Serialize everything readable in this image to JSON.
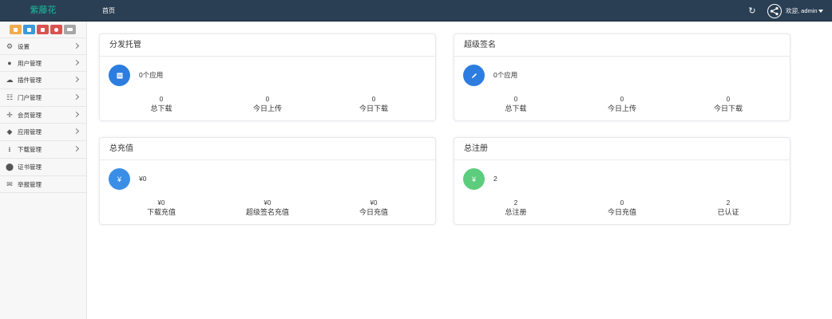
{
  "header": {
    "brand": "紫藤花",
    "nav_home": "首页",
    "welcome": "欢迎, admin",
    "refresh_icon": "refresh-icon",
    "avatar_icon": "share-nodes-icon"
  },
  "sidebar": {
    "quick_buttons": [
      {
        "icon": "home-icon",
        "color": "#f0ad4e"
      },
      {
        "icon": "file-icon",
        "color": "#3a9ad9"
      },
      {
        "icon": "trash-icon",
        "color": "#d9534f"
      },
      {
        "icon": "gear-icon",
        "color": "#d9534f"
      },
      {
        "icon": "list-icon",
        "color": "#a6a6a6"
      }
    ],
    "items": [
      {
        "label": "设置",
        "icon": "gears-icon",
        "arrow": true
      },
      {
        "label": "用户管理",
        "icon": "users-icon",
        "arrow": true
      },
      {
        "label": "插件管理",
        "icon": "cloud-icon",
        "arrow": true
      },
      {
        "label": "门户管理",
        "icon": "grid-icon",
        "arrow": true
      },
      {
        "label": "会员管理",
        "icon": "arrows-icon",
        "arrow": true
      },
      {
        "label": "应用管理",
        "icon": "android-icon",
        "arrow": true
      },
      {
        "label": "下载管理",
        "icon": "download-icon",
        "arrow": true
      },
      {
        "label": "证书管理",
        "icon": "certificate-icon",
        "arrow": false
      },
      {
        "label": "举报管理",
        "icon": "envelope-open-icon",
        "arrow": false
      }
    ]
  },
  "panels": [
    {
      "title": "分发托管",
      "headline": "0个应用",
      "icon": "list-square-icon",
      "icon_color": "#2d7de0",
      "stats": [
        {
          "value": "0",
          "label": "总下载"
        },
        {
          "value": "0",
          "label": "今日上传"
        },
        {
          "value": "0",
          "label": "今日下载"
        }
      ]
    },
    {
      "title": "超级签名",
      "headline": "0个应用",
      "icon": "pencil-icon",
      "icon_color": "#2d7de0",
      "stats": [
        {
          "value": "0",
          "label": "总下载"
        },
        {
          "value": "0",
          "label": "今日上传"
        },
        {
          "value": "0",
          "label": "今日下载"
        }
      ]
    },
    {
      "title": "总充值",
      "headline": "¥0",
      "icon": "yen-icon",
      "icon_color": "#3a8ee6",
      "stats": [
        {
          "value": "¥0",
          "label": "下载充值"
        },
        {
          "value": "¥0",
          "label": "超级签名充值"
        },
        {
          "value": "¥0",
          "label": "今日充值"
        }
      ]
    },
    {
      "title": "总注册",
      "headline": "2",
      "icon": "yen-icon",
      "icon_color": "#5ccd7d",
      "stats": [
        {
          "value": "2",
          "label": "总注册"
        },
        {
          "value": "0",
          "label": "今日充值"
        },
        {
          "value": "2",
          "label": "已认证"
        }
      ]
    }
  ]
}
